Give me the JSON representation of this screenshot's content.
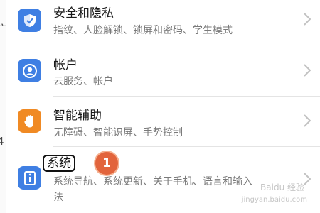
{
  "settings": {
    "items": [
      {
        "title": "安全和隐私",
        "subtitle": "指纹、人脸解锁、锁屏和密码、学生模式",
        "icon": "shield-icon",
        "icon_color": "#3f7fe3"
      },
      {
        "title": "帐户",
        "subtitle": "云服务、帐户",
        "icon": "account-icon",
        "icon_color": "#3f7fe3"
      },
      {
        "title": "智能辅助",
        "subtitle": "无障碍、智能识屏、手势控制",
        "icon": "hand-icon",
        "icon_color": "#f08a24"
      },
      {
        "title": "系统",
        "subtitle": "系统导航、系统更新、关于手机、语言和输入",
        "subtitle_wrap": "法",
        "icon": "info-icon",
        "icon_color": "#3f7fe3"
      }
    ]
  },
  "annotation": {
    "badge_number": "1",
    "badge_color": "#e2643c"
  },
  "watermark": {
    "text": "Baidu 经验",
    "url": "jingyan.baidu.com"
  }
}
